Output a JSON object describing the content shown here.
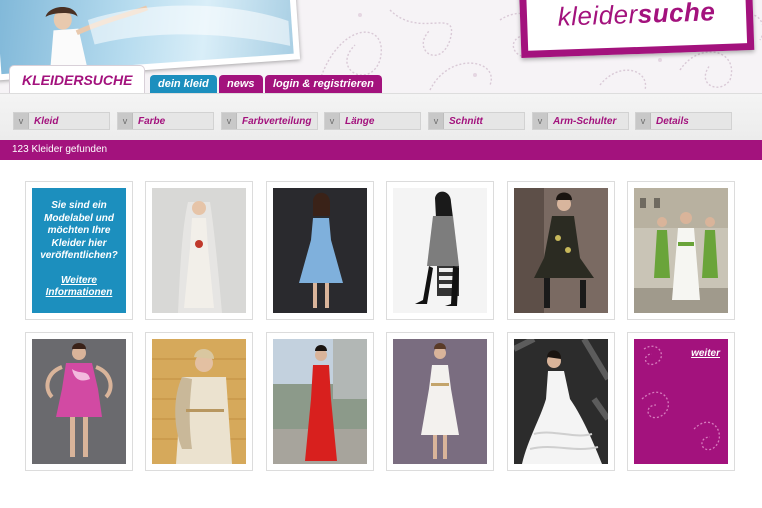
{
  "brand": {
    "logo_text_light": "kleider",
    "logo_text_bold": "suche"
  },
  "tabs": {
    "main": "KLEIDERSUCHE",
    "items": [
      {
        "label": "dein kleid",
        "color": "#1c8fbe"
      },
      {
        "label": "news",
        "color": "#a3127d"
      },
      {
        "label": "login & registrieren",
        "color": "#a3127d"
      }
    ]
  },
  "filters": [
    "Kleid",
    "Farbe",
    "Farbverteilung",
    "Länge",
    "Schnitt",
    "Arm-Schulter",
    "Details"
  ],
  "filter_chevron": "v",
  "results": {
    "count_text": "123 Kleider gefunden"
  },
  "promo": {
    "text": "Sie sind ein Modelabel und möchten Ihre Kleider hier veröffentlichen?",
    "link": "Weitere Informationen"
  },
  "more": {
    "label": "weiter"
  },
  "colors": {
    "accent": "#a3127d",
    "blue": "#1c8fbe"
  },
  "grid": {
    "row1": [
      {
        "type": "promo"
      },
      {
        "type": "photo",
        "dress": "white bridal gown with veil",
        "dress_color": "#f2efe9",
        "bg": "#d8d8d6"
      },
      {
        "type": "photo",
        "dress": "light blue short dress",
        "dress_color": "#7fb0dc",
        "bg": "#2a2a2e"
      },
      {
        "type": "photo",
        "dress": "grey knit dress, seated",
        "dress_color": "#7d7d7d",
        "bg": "#f4f4f4"
      },
      {
        "type": "photo",
        "dress": "black patterned dress, seated",
        "dress_color": "#2b2b22",
        "bg": "#7a6a62"
      },
      {
        "type": "photo",
        "dress": "bride with green bridesmaids",
        "dress_color": "#f6f6f2",
        "bg": "#c9c4b6"
      }
    ],
    "row2": [
      {
        "type": "photo",
        "dress": "pink ruffled short dress",
        "dress_color": "#d24aa3",
        "bg": "#6a6a6e"
      },
      {
        "type": "photo",
        "dress": "cream dress with shawl",
        "dress_color": "#ebe2cf",
        "bg": "#d6a95b"
      },
      {
        "type": "photo",
        "dress": "red long gown",
        "dress_color": "#d8201e",
        "bg": "#8c9a8a"
      },
      {
        "type": "photo",
        "dress": "white short dress",
        "dress_color": "#f3f1ee",
        "bg": "#7a6d80"
      },
      {
        "type": "photo",
        "dress": "white ruffled bridal gown",
        "dress_color": "#f4f4f4",
        "bg": "#2c2c2c"
      },
      {
        "type": "more"
      }
    ]
  }
}
